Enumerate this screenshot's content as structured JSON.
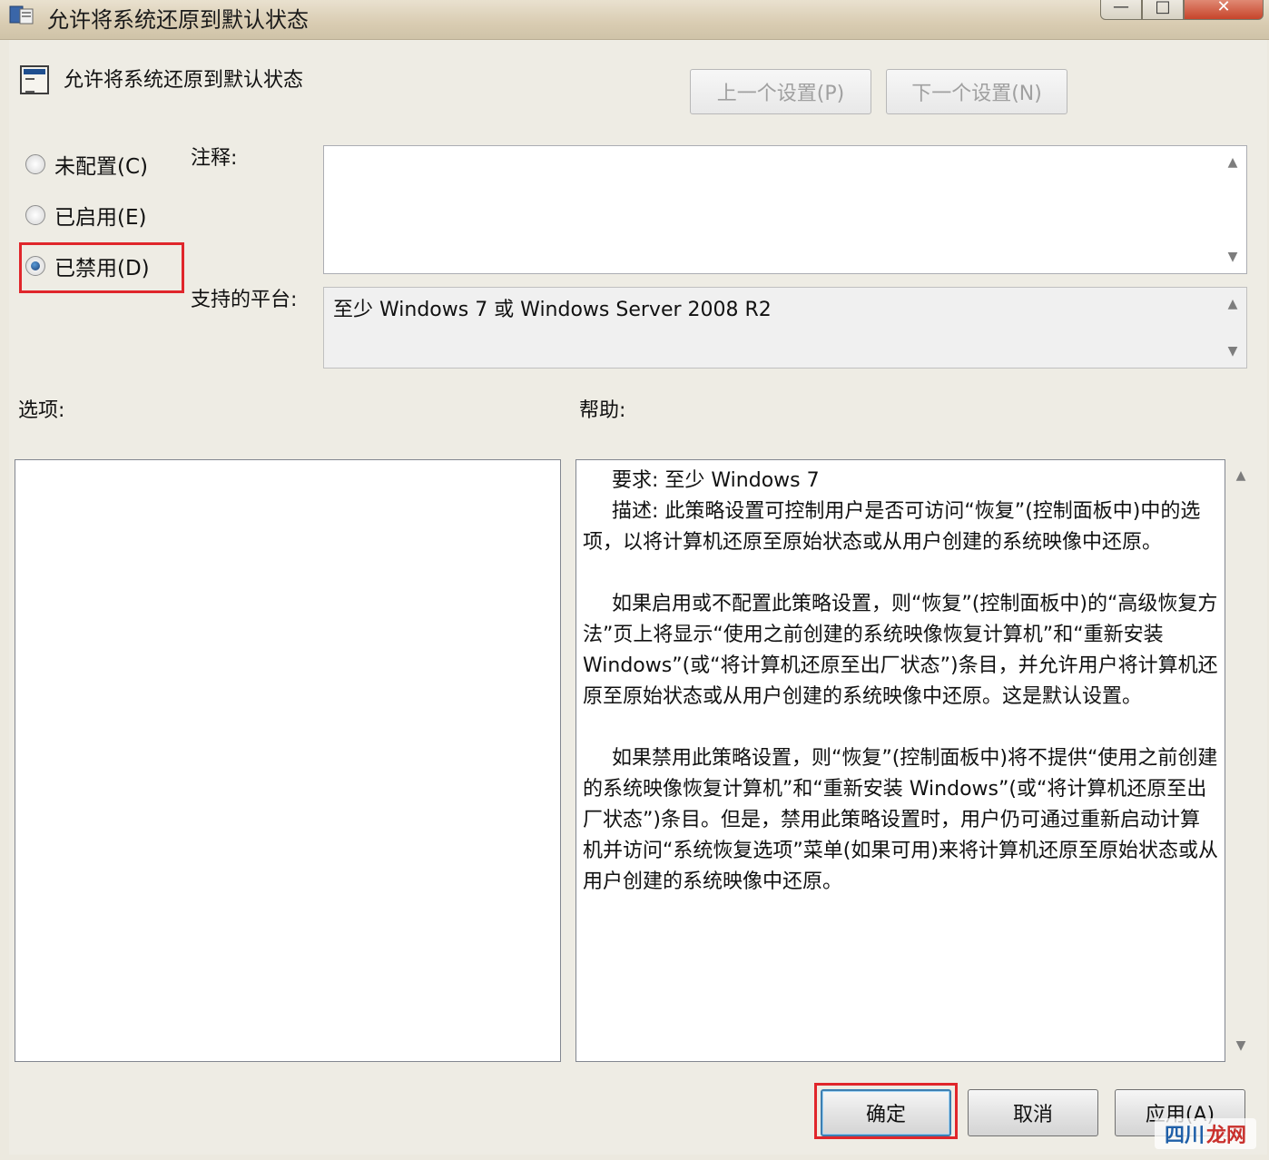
{
  "window": {
    "title": "允许将系统还原到默认状态",
    "controls": {
      "minimize": "—",
      "maximize": "□",
      "close": "✕"
    }
  },
  "header": {
    "title": "允许将系统还原到默认状态",
    "prev_button": "上一个设置(P)",
    "next_button": "下一个设置(N)"
  },
  "state_options": [
    {
      "label": "未配置(C)",
      "checked": false
    },
    {
      "label": "已启用(E)",
      "checked": false
    },
    {
      "label": "已禁用(D)",
      "checked": true
    }
  ],
  "comment": {
    "label": "注释:",
    "value": ""
  },
  "platform": {
    "label": "支持的平台:",
    "value": "至少 Windows 7 或 Windows Server 2008 R2"
  },
  "sections": {
    "options_label": "选项:",
    "help_label": "帮助:"
  },
  "help": {
    "line1": "要求: 至少 Windows 7",
    "para1": "描述: 此策略设置可控制用户是否可访问“恢复”(控制面板中)中的选项，以将计算机还原至原始状态或从用户创建的系统映像中还原。",
    "para2": "如果启用或不配置此策略设置，则“恢复”(控制面板中)的“高级恢复方法”页上将显示“使用之前创建的系统映像恢复计算机”和“重新安装 Windows”(或“将计算机还原至出厂状态”)条目，并允许用户将计算机还原至原始状态或从用户创建的系统映像中还原。这是默认设置。",
    "para3": "如果禁用此策略设置，则“恢复”(控制面板中)将不提供“使用之前创建的系统映像恢复计算机”和“重新安装 Windows”(或“将计算机还原至出厂状态”)条目。但是，禁用此策略设置时，用户仍可通过重新启动计算机并访问“系统恢复选项”菜单(如果可用)来将计算机还原至原始状态或从用户创建的系统映像中还原。"
  },
  "buttons": {
    "ok": "确定",
    "cancel": "取消",
    "apply": "应用(A)"
  },
  "watermark": {
    "part1": "四川",
    "part2": "龙网"
  },
  "colors": {
    "highlight": "#e0262b",
    "accent": "#1b3e73"
  }
}
